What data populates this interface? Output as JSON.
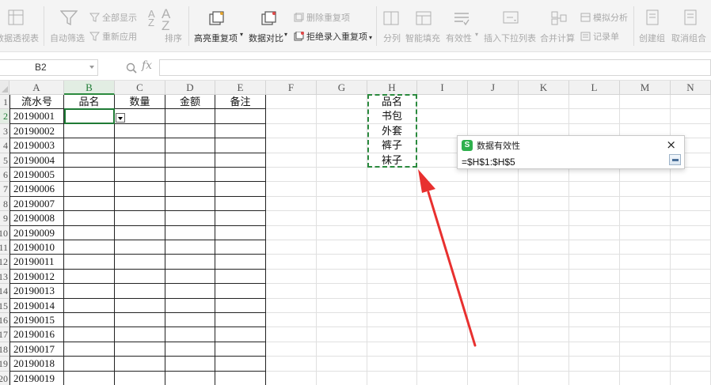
{
  "ribbon": {
    "pivot_label": "数据透视表",
    "autofilter_label": "自动筛选",
    "show_all_label": "全部显示",
    "reapply_label": "重新应用",
    "sort_label": "排序",
    "highlight_dup_label": "高亮重复项",
    "compare_label": "数据对比",
    "delete_dup_label": "删除重复项",
    "reject_dup_label": "拒绝录入重复项",
    "split_label": "分列",
    "fill_label": "智能填充",
    "validity_label": "有效性",
    "dropdown_list_label": "插入下拉列表",
    "consolidate_label": "合并计算",
    "whatif_label": "模拟分析",
    "records_label": "记录单",
    "group_label": "创建组",
    "ungroup_label": "取消组合"
  },
  "formula_bar": {
    "name_box": "B2",
    "fx": "fx",
    "formula": ""
  },
  "columns": [
    "A",
    "B",
    "C",
    "D",
    "E",
    "F",
    "G",
    "H",
    "I",
    "J",
    "K",
    "L",
    "M",
    "N"
  ],
  "selected_column": "B",
  "row_numbers": [
    "1",
    "2",
    "3",
    "4",
    "5",
    "6",
    "7",
    "8",
    "9",
    "10",
    "11",
    "12",
    "13",
    "14",
    "15",
    "16",
    "17",
    "18",
    "19",
    "20"
  ],
  "selected_row": "2",
  "table": {
    "headers": [
      "流水号",
      "品名",
      "数量",
      "金额",
      "备注"
    ],
    "serials": [
      "20190001",
      "20190002",
      "20190003",
      "20190004",
      "20190005",
      "20190006",
      "20190007",
      "20190008",
      "20190009",
      "20190010",
      "20190011",
      "20190012",
      "20190013",
      "20190014",
      "20190015",
      "20190016",
      "20190017",
      "20190018",
      "20190019"
    ]
  },
  "source_list": {
    "header": "品名",
    "items": [
      "书包",
      "外套",
      "裤子",
      "袜子"
    ]
  },
  "dialog": {
    "logo": "S",
    "title": "数据有效性",
    "close": "×",
    "reference": "=$H$1:$H$5"
  },
  "colors": {
    "accent_green": "#2b8a3e",
    "arrow_red": "#e8302f",
    "dialog_logo": "#2fb04d"
  }
}
